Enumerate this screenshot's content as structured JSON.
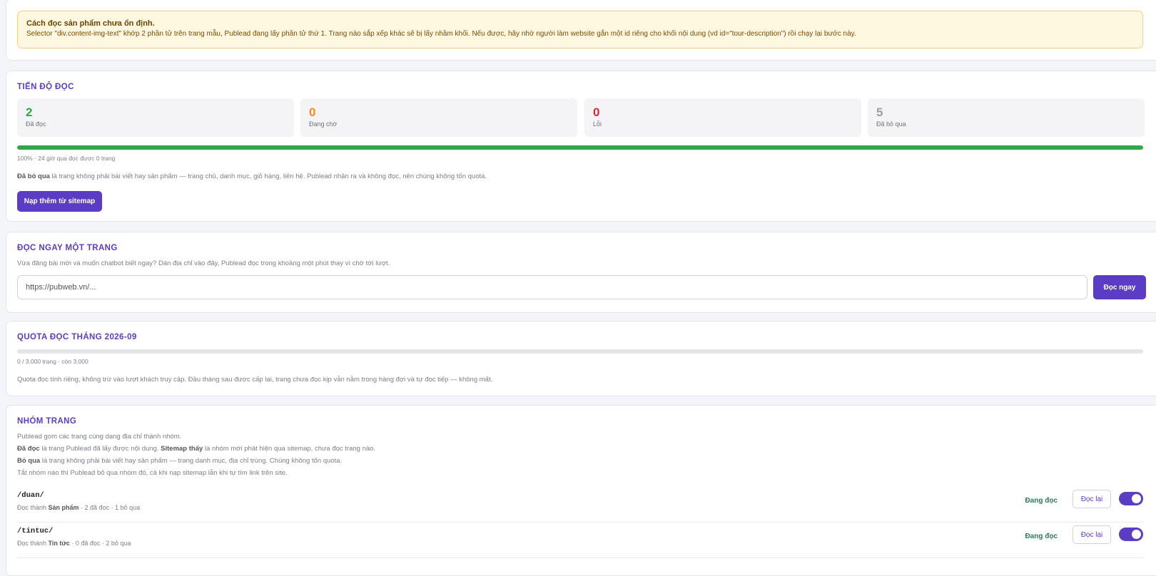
{
  "warning": {
    "title": "Cách đọc sản phẩm chưa ổn định.",
    "body": "Selector \"div.content-img-text\" khớp 2 phần tử trên trang mẫu, Publead đang lấy phần tử thứ 1. Trang nào sắp xếp khác sẽ bị lấy nhầm khối. Nếu được, hãy nhờ người làm website gắn một id riêng cho khối nội dung (vd id=\"tour-description\") rồi chạy lại bước này."
  },
  "progress": {
    "title": "TIẾN ĐỘ ĐỌC",
    "stats": [
      {
        "value": "2",
        "label": "Đã đọc",
        "color": "#2ea84a"
      },
      {
        "value": "0",
        "label": "Đang chờ",
        "color": "#f08c1e"
      },
      {
        "value": "0",
        "label": "Lỗi",
        "color": "#d9263a"
      },
      {
        "value": "5",
        "label": "Đã bỏ qua",
        "color": "#9a9ea6"
      }
    ],
    "percent": 100,
    "summary": "100% · 24 giờ qua đọc được 0 trang",
    "note_bold": "Đã bỏ qua",
    "note_rest": " là trang không phải bài viết hay sản phẩm — trang chủ, danh mục, giỏ hàng, liên hệ. Publead nhận ra và không đọc, nên chúng không tốn quota.",
    "button": "Nạp thêm từ sitemap"
  },
  "read_now": {
    "title": "ĐỌC NGAY MỘT TRANG",
    "desc": "Vừa đăng bài mới và muốn chatbot biết ngay? Dán địa chỉ vào đây, Publead đọc trong khoảng một phút thay vì chờ tới lượt.",
    "placeholder": "https://pubweb.vn/...",
    "button": "Đọc ngay"
  },
  "quota": {
    "title": "QUOTA ĐỌC THÁNG 2026-09",
    "used_fraction": 0,
    "summary": "0 / 3.000 trang · còn 3.000",
    "desc": "Quota đọc tính riêng, không trừ vào lượt khách truy cập. Đầu tháng sau được cấp lại, trang chưa đọc kịp vẫn nằm trong hàng đợi và tự đọc tiếp — không mất."
  },
  "groups": {
    "title": "NHÓM TRANG",
    "desc1": "Publead gom các trang cùng dạng địa chỉ thành nhóm.",
    "desc2_b1": "Đã đọc",
    "desc2_r1": " là trang Publead đã lấy được nội dung. ",
    "desc2_b2": "Sitemap thấy",
    "desc2_r2": " là nhóm mới phát hiện qua sitemap, chưa đọc trang nào.",
    "desc3_b": "Bỏ qua",
    "desc3_r": " là trang không phải bài viết hay sản phẩm — trang danh mục, địa chỉ trùng. Chúng không tốn quota.",
    "desc4": "Tắt nhóm nào thì Publead bỏ qua nhóm đó, cả khi nạp sitemap lẫn khi tự tìm link trên site.",
    "rows": [
      {
        "path": "/duan/",
        "meta_pre": "Đọc thành ",
        "meta_type": "Sản phẩm",
        "meta_post": " · 2 đã đọc · 1 bỏ qua",
        "status": "Đang đọc",
        "button": "Đọc lại",
        "enabled": true
      },
      {
        "path": "/tintuc/",
        "meta_pre": "Đọc thành ",
        "meta_type": "Tin tức",
        "meta_post": " · 0 đã đọc · 2 bỏ qua",
        "status": "Đang đọc",
        "button": "Đọc lại",
        "enabled": true
      }
    ]
  }
}
